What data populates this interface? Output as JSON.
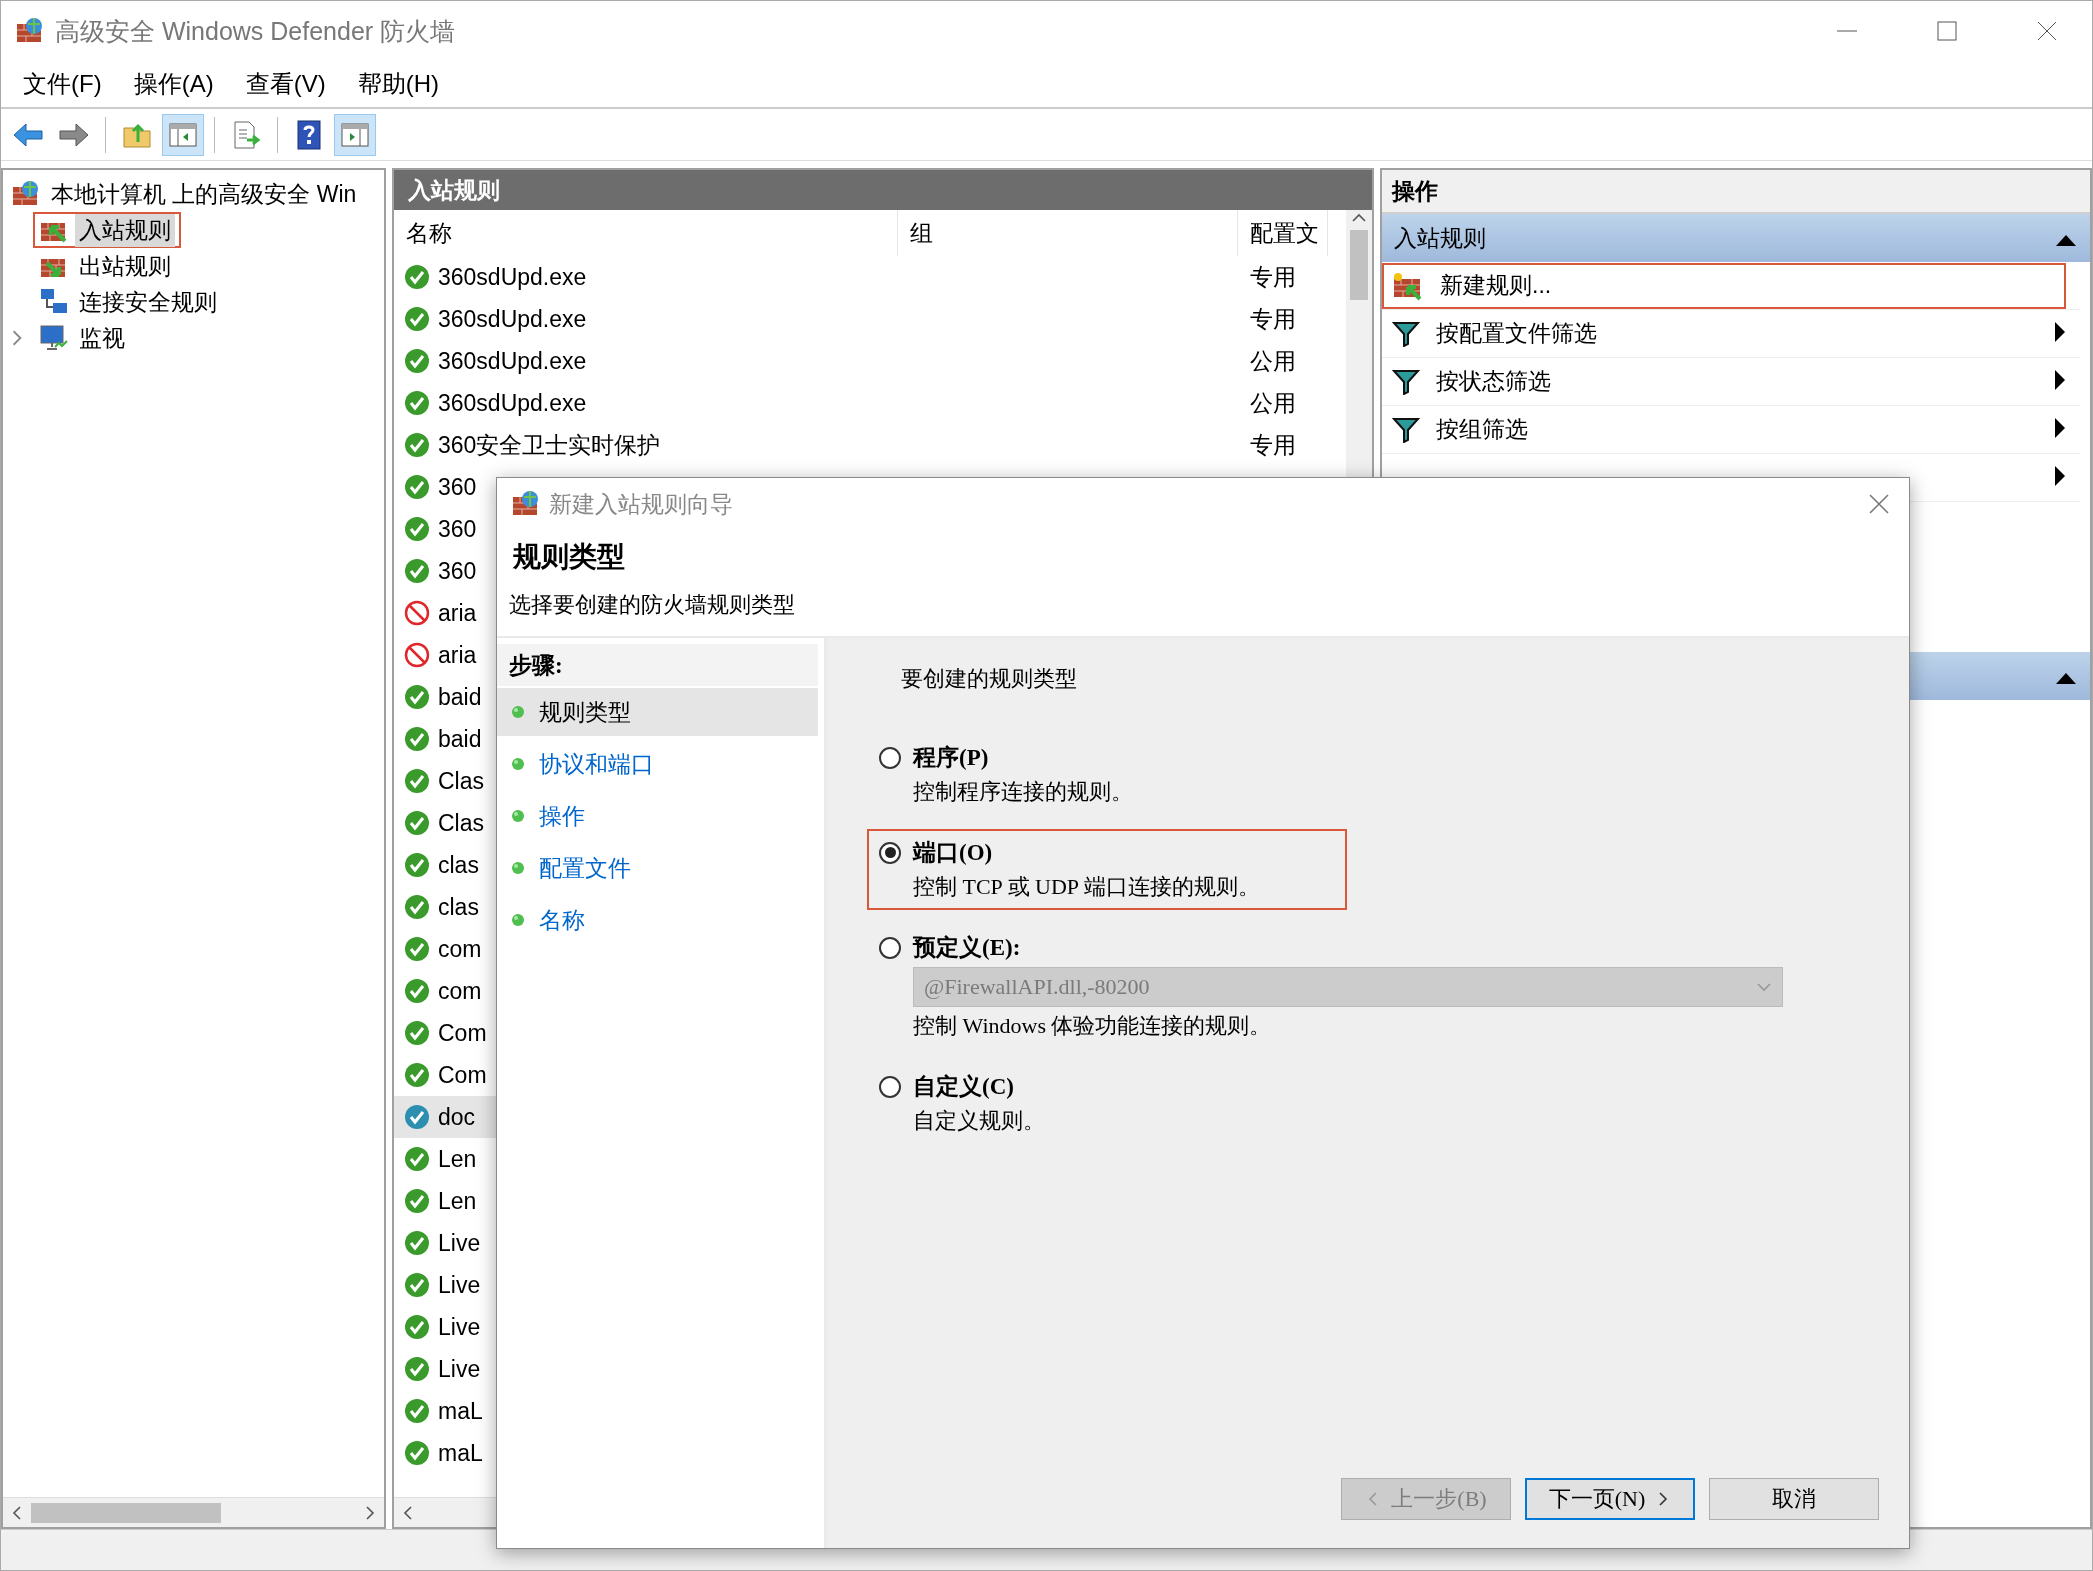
{
  "window": {
    "title": "高级安全 Windows Defender 防火墙"
  },
  "menu": [
    "文件(F)",
    "操作(A)",
    "查看(V)",
    "帮助(H)"
  ],
  "toolbar": [
    {
      "kind": "back",
      "pressed": false
    },
    {
      "kind": "forward",
      "pressed": false
    },
    {
      "kind": "sep"
    },
    {
      "kind": "up",
      "pressed": false
    },
    {
      "kind": "tree",
      "pressed": true
    },
    {
      "kind": "sep"
    },
    {
      "kind": "export",
      "pressed": false
    },
    {
      "kind": "sep"
    },
    {
      "kind": "help",
      "pressed": false
    },
    {
      "kind": "actions",
      "pressed": true
    }
  ],
  "tree": {
    "label": "本地计算机 上的高级安全 Win",
    "children": [
      {
        "label": "入站规则",
        "kind": "inbound",
        "selected": true,
        "highlighted": true,
        "collapsed": false
      },
      {
        "label": "出站规则",
        "kind": "outbound",
        "selected": false,
        "highlighted": false,
        "collapsed": false
      },
      {
        "label": "连接安全规则",
        "kind": "network",
        "selected": false,
        "highlighted": false,
        "collapsed": false
      },
      {
        "label": "监视",
        "kind": "monitor",
        "selected": false,
        "highlighted": false,
        "collapsed": true
      }
    ]
  },
  "rules": {
    "title": "入站规则",
    "columns": [
      "名称",
      "组",
      "配置文"
    ],
    "rows": [
      {
        "name": "360sdUpd.exe",
        "profile": "专用",
        "kind": "allow",
        "selected": false
      },
      {
        "name": "360sdUpd.exe",
        "profile": "专用",
        "kind": "allow",
        "selected": false
      },
      {
        "name": "360sdUpd.exe",
        "profile": "公用",
        "kind": "allow",
        "selected": false
      },
      {
        "name": "360sdUpd.exe",
        "profile": "公用",
        "kind": "allow",
        "selected": false
      },
      {
        "name": "360安全卫士实时保护",
        "profile": "专用",
        "kind": "allow",
        "selected": false
      },
      {
        "name": "360",
        "kind": "allow",
        "selected": false
      },
      {
        "name": "360",
        "kind": "allow",
        "selected": false
      },
      {
        "name": "360",
        "kind": "allow",
        "selected": false
      },
      {
        "name": "aria",
        "kind": "block",
        "selected": false
      },
      {
        "name": "aria",
        "kind": "block",
        "selected": false
      },
      {
        "name": "baid",
        "kind": "allow",
        "selected": false
      },
      {
        "name": "baid",
        "kind": "allow",
        "selected": false
      },
      {
        "name": "Clas",
        "kind": "allow",
        "selected": false
      },
      {
        "name": "Clas",
        "kind": "allow",
        "selected": false
      },
      {
        "name": "clas",
        "kind": "allow",
        "selected": false
      },
      {
        "name": "clas",
        "kind": "allow",
        "selected": false
      },
      {
        "name": "com",
        "kind": "allow",
        "selected": false
      },
      {
        "name": "com",
        "kind": "allow",
        "selected": false
      },
      {
        "name": "Com",
        "kind": "allow",
        "selected": false
      },
      {
        "name": "Com",
        "kind": "allow",
        "selected": false
      },
      {
        "name": "doc",
        "kind": "allow-alt",
        "selected": true
      },
      {
        "name": "Len",
        "kind": "allow",
        "selected": false
      },
      {
        "name": "Len",
        "kind": "allow",
        "selected": false
      },
      {
        "name": "Live",
        "kind": "allow",
        "selected": false
      },
      {
        "name": "Live",
        "kind": "allow",
        "selected": false
      },
      {
        "name": "Live",
        "kind": "allow",
        "selected": false
      },
      {
        "name": "Live",
        "kind": "allow",
        "selected": false
      },
      {
        "name": "maL",
        "kind": "allow",
        "selected": false
      },
      {
        "name": "maL",
        "kind": "allow",
        "selected": false
      }
    ]
  },
  "actions": {
    "title": "操作",
    "sections": [
      {
        "title": "入站规则",
        "expanded": true,
        "items": [
          {
            "label": "新建规则...",
            "kind": "new",
            "submenu": false,
            "highlighted": true
          },
          {
            "label": "按配置文件筛选",
            "kind": "filter",
            "submenu": true,
            "highlighted": false
          },
          {
            "label": "按状态筛选",
            "kind": "filter",
            "submenu": true,
            "highlighted": false
          },
          {
            "label": "按组筛选",
            "kind": "filter",
            "submenu": true,
            "highlighted": false
          },
          {
            "kind": "hidden",
            "submenu": true,
            "highlighted": false
          }
        ]
      },
      {
        "expanded": true
      }
    ]
  },
  "wizard": {
    "title": "新建入站规则向导",
    "heading": "规则类型",
    "subtitle": "选择要创建的防火墙规则类型",
    "steps_label": "步骤:",
    "steps": [
      {
        "label": "规则类型",
        "selected": true
      },
      {
        "label": "协议和端口",
        "selected": false
      },
      {
        "label": "操作",
        "selected": false
      },
      {
        "label": "配置文件",
        "selected": false
      },
      {
        "label": "名称",
        "selected": false
      }
    ],
    "prompt": "要创建的规则类型",
    "options": [
      {
        "label": "程序(P)",
        "description": "控制程序连接的规则。",
        "selected": false,
        "highlighted": false
      },
      {
        "label": "端口(O)",
        "description": "控制 TCP 或 UDP 端口连接的规则。",
        "selected": true,
        "highlighted": true
      },
      {
        "label": "预定义(E):",
        "dropdown": {
          "value": "@FirewallAPI.dll,-80200",
          "disabled": true
        },
        "description": "控制 Windows 体验功能连接的规则。",
        "selected": false,
        "highlighted": false
      },
      {
        "label": "自定义(C)",
        "description": "自定义规则。",
        "selected": false,
        "highlighted": false
      }
    ],
    "buttons": [
      {
        "label": "上一步(B)",
        "kind": "back",
        "disabled": true,
        "default": false
      },
      {
        "label": "下一页(N)",
        "kind": "next",
        "disabled": false,
        "default": true
      },
      {
        "label": "取消",
        "kind": "cancel",
        "disabled": false,
        "default": false
      }
    ]
  }
}
